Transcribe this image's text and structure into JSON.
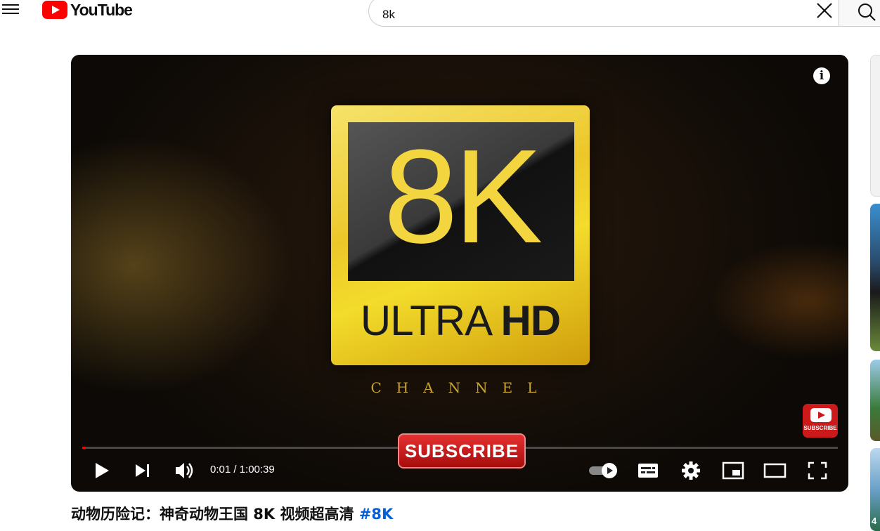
{
  "header": {
    "logo_text": "YouTube",
    "search_value": "8k"
  },
  "player": {
    "badge_big": "8K",
    "badge_ultra": "ULTRA",
    "badge_hd": "HD",
    "channel_label": "CHANNEL",
    "subscribe_button": "SUBSCRIBE",
    "subscribe_corner": "SUBSCRIBE",
    "info_glyph": "i",
    "time_display": "0:01 / 1:00:39",
    "progress_fraction": 0.004
  },
  "video": {
    "title": "动物历险记：神奇动物王国 8K 视频超高清",
    "hashtag": "#8K"
  },
  "sidebar": {
    "peek_label": "4"
  },
  "colors": {
    "brand_red": "#ff0000",
    "hashtag_blue": "#065fd4",
    "badge_gold": "#f3d540"
  },
  "icons": [
    "menu-icon",
    "youtube-logo-icon",
    "clear-icon",
    "search-icon",
    "info-icon",
    "play-icon",
    "next-icon",
    "volume-icon",
    "autoplay-toggle-icon",
    "subtitles-icon",
    "settings-icon",
    "miniplayer-icon",
    "theater-mode-icon",
    "fullscreen-icon"
  ]
}
